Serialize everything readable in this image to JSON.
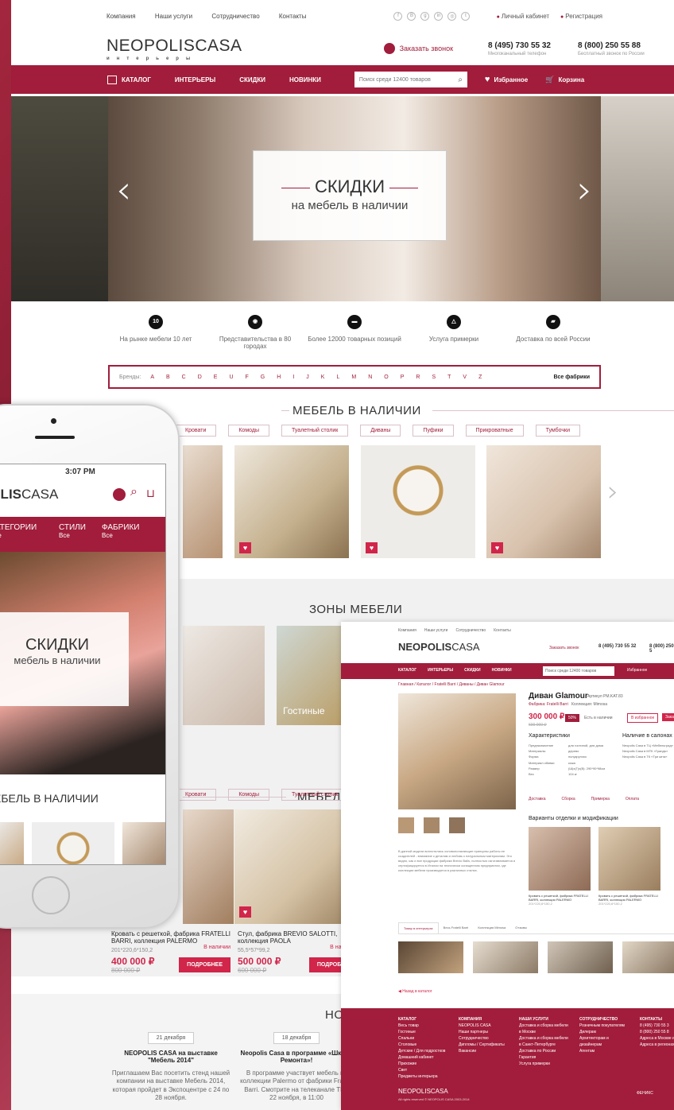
{
  "topbar": {
    "nav": [
      "Компания",
      "Наши услуги",
      "Сотрудничество",
      "Контакты"
    ],
    "social": [
      "f",
      "B",
      "g",
      "in",
      "◎",
      "t"
    ],
    "account": "Личный кабинет",
    "register": "Регистрация"
  },
  "header": {
    "logo_bold": "NEOPOLIS",
    "logo_light": "CASA",
    "logo_tag": "интерьеры",
    "callback": "Заказать звонок",
    "phone1": "8 (495) 730 55 32",
    "phone1_note": "Многоканальный телефон",
    "phone2": "8 (800) 250 55 88",
    "phone2_note": "Бесплатный звонок по России"
  },
  "menu": {
    "catalog": "КАТАЛОГ",
    "items": [
      "ИНТЕРЬЕРЫ",
      "СКИДКИ",
      "НОВИНКИ"
    ],
    "search_placeholder": "Поиск среди 12400 товаров",
    "favorites": "Избранное",
    "cart": "Корзина"
  },
  "hero": {
    "title": "СКИДКИ",
    "subtitle": "на мебель в наличии"
  },
  "features": [
    {
      "icon": "10",
      "text": "На рынке мебели 10 лет"
    },
    {
      "icon": "",
      "text": "Представительства в 80 городах"
    },
    {
      "icon": "",
      "text": "Более 12000 товарных позиций"
    },
    {
      "icon": "",
      "text": "Услуга примерки"
    },
    {
      "icon": "",
      "text": "Доставка по всей России"
    }
  ],
  "brands": {
    "label": "Бренды:",
    "letters": [
      "A",
      "B",
      "C",
      "D",
      "E",
      "U",
      "F",
      "G",
      "H",
      "I",
      "J",
      "K",
      "L",
      "M",
      "N",
      "O",
      "P",
      "R",
      "S",
      "T",
      "V",
      "Z"
    ],
    "all": "Все фабрики"
  },
  "in_stock": {
    "title": "МЕБЕЛЬ В НАЛИЧИИ",
    "chips": [
      "Кровати",
      "Комоды",
      "Туалетный столик",
      "Диваны",
      "Пуфики",
      "Прикроватные",
      "Тумбочки"
    ]
  },
  "zones": {
    "title": "ЗОНЫ МЕБЕЛИ",
    "living": "Гостиные"
  },
  "in_stock2": {
    "title": "МЕБЕЛЬ С",
    "chips": [
      "Кровати",
      "Комоды",
      "Туалетный столик"
    ]
  },
  "products": [
    {
      "name": "Кровать с решеткой, фабрика FRATELLI BARRI, коллекция PALERMO",
      "size": "201*220,6*150,2",
      "avail": "В наличии",
      "price": "400 000 ₽",
      "old": "800 000 ₽",
      "btn": "ПОДРОБНЕЕ"
    },
    {
      "name": "Стул, фабрика BREVIO SALOTTI, коллекция PAOLA",
      "size": "55,5*57*99,2",
      "avail": "В наличии",
      "price": "500 000 ₽",
      "old": "600 000 ₽",
      "btn": "ПОДРОБНЕ"
    }
  ],
  "news": {
    "title": "НО",
    "items": [
      {
        "date": "21 декабря",
        "title": "NEOPOLIS CASA на выставке \"Мебель 2014\"",
        "text": "Приглашаем Вас посетить стенд нашей компании на выставке Мебель 2014, которая пройдет в Экспоцентре с 24 по 28 ноября."
      },
      {
        "date": "18 декабря",
        "title": "Neopolis Casa в программе «Школа Ремонта»!",
        "text": "В программе участвует мебель из коллекции Palermo от фабрики Fratelli Barri. Смотрите на телеканале ТНТ 22 ноября, в 11:00"
      }
    ]
  },
  "phone": {
    "time": "3:07 PM",
    "logo_bold": "POLIS",
    "logo_light": "CASA",
    "tabs": [
      {
        "label": "КАТЕГОРИИ",
        "sub": "Все"
      },
      {
        "label": "СТИЛИ",
        "sub": "Все"
      },
      {
        "label": "ФАБРИКИ",
        "sub": "Все"
      }
    ],
    "hero_title": "СКИДКИ",
    "hero_sub": "мебель в наличии",
    "section": "ЕБЕЛЬ В НАЛИЧИИ"
  },
  "product_page": {
    "topnav": [
      "Компания",
      "Наши услуги",
      "Сотрудничество",
      "Контакты"
    ],
    "callback": "Заказать звонок",
    "phone1": "8 (495) 730 55 32",
    "phone2": "8 (800) 250 5",
    "menu": [
      "КАТАЛОГ",
      "ИНТЕРЬЕРЫ",
      "СКИДКИ",
      "НОВИНКИ"
    ],
    "search": "Поиск среди 12400 товаров",
    "favorites": "Избранное",
    "breadcrumbs": "Главная / Каталог / Fratelli Barri / Диваны / Диван Glamour",
    "name": "Диван Glamour",
    "sku": "Артикул PM.KAT.83",
    "factory": "Фабрика: Fratelli Barri",
    "collection": "Коллекция: Mimosa",
    "price": "300 000 ₽",
    "old_price": "600 000 ₽",
    "discount": "50%",
    "stock": "Есть в наличии",
    "fav_btn": "В избранное",
    "buy_btn": "Заказ",
    "specs_title": "Характеристики",
    "specs": [
      [
        "Предназначение",
        "для гостиной, для дома"
      ],
      [
        "Материалы",
        "дерево"
      ],
      [
        "Форма",
        "полукруглая"
      ],
      [
        "Материал обивки",
        "кожа"
      ],
      [
        "Размер",
        "(Ш)х(Г)х(В): 290*90*98см"
      ],
      [
        "Вес",
        "104 кг"
      ]
    ],
    "salons_title": "Наличие в салонах",
    "salons": [
      "Neopolis Casa в ТЦ «Мебельград»",
      "Neopolis Casa в МТК «Грандъ»",
      "Neopolis Casa в ТК «Три кита»"
    ],
    "services": [
      "Доставка",
      "Сборка",
      "Примерка",
      "Оплата"
    ],
    "variants_title": "Варианты отделки и модификации",
    "variants": [
      {
        "name": "Кровать с решеткой, фабрика FRATELLI BARRI, коллекция PALERMO",
        "size": "201*220,6*150,2"
      },
      {
        "name": "Кровать с решеткой, фабрика FRATELLI BARRI, коллекция PALERMO",
        "size": "201*220,6*150,2"
      }
    ],
    "description": "В данной модели воплотились основополагающие принципы работы ее создателей - внимание к деталям и любовь к натуральным материалам. Это видно, как и все продукции фабрики Brevio Balis, полностью изготавливается и сертифицируется в Италии на технически оснащенном предприятии, где коллекции мебели производятся в различных стилях.",
    "tabs": [
      "Товар в интерьерах",
      "Весь Fratelli Barri",
      "Коллекция Mimosa",
      "Отзывы"
    ],
    "back": "Назад в каталог",
    "footer_cols": [
      {
        "title": "КАТАЛОГ",
        "items": [
          "Весь товар",
          "Гостиные",
          "Спальни",
          "Столовые",
          "Детские / Для подростков",
          "Домашний кабинет",
          "Прихожие",
          "Свет",
          "Предметы интерьера"
        ]
      },
      {
        "title": "КОМПАНИЯ",
        "items": [
          "NEOPOLIS CASA",
          "Наши партнеры",
          "Сотрудничество",
          "Дипломы / Сертификаты",
          "Вакансии"
        ]
      },
      {
        "title": "НАШИ УСЛУГИ",
        "items": [
          "Доставка и сборка мебели в Москве",
          "Доставка и сборка мебели в Санкт-Петербурге",
          "Доставка по России",
          "Гарантия",
          "Услуга примерки"
        ]
      },
      {
        "title": "СОТРУДНИЧЕСТВО",
        "items": [
          "Розничным покупателям",
          "Дилерам",
          "Архитекторам и дизайнерам",
          "Агентам"
        ]
      },
      {
        "title": "КОНТАКТЫ",
        "items": [
          "8 (495) 730 55 3",
          "8 (800) 250 55 8",
          "Адреса в Москве и МО",
          "Адреса в регионах Рос"
        ]
      }
    ],
    "footer_logo": "NEOPOLISCASA",
    "copyright": "All rights reserved © NEOPOLIS CASA 2003-2014",
    "dev": "ФЕНИКС"
  },
  "colors": {
    "brand": "#a11d3b",
    "accent": "#d1254a"
  }
}
